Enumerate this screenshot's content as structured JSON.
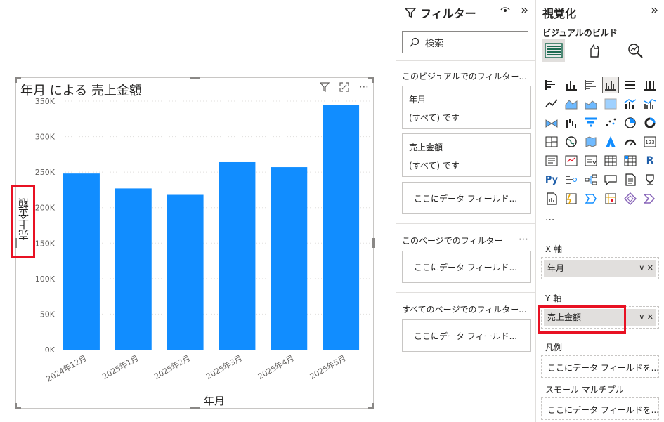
{
  "visual": {
    "title": "年月 による 売上金額",
    "icons": [
      "filter-icon",
      "focus-mode-icon",
      "more-options-icon"
    ],
    "x_axis_label": "年月",
    "y_axis_label": "売上金額"
  },
  "chart_data": {
    "type": "bar",
    "title": "年月 による 売上金額",
    "xlabel": "年月",
    "ylabel": "売上金額",
    "categories": [
      "2024年12月",
      "2025年1月",
      "2025年2月",
      "2025年3月",
      "2025年4月",
      "2025年5月"
    ],
    "values": [
      248000,
      227000,
      218000,
      264000,
      257000,
      345000
    ],
    "ylim": [
      0,
      350000
    ],
    "ytick_labels": [
      "0K",
      "50K",
      "100K",
      "150K",
      "200K",
      "250K",
      "300K",
      "350K"
    ],
    "color": "#118DFF",
    "grid": true
  },
  "filters": {
    "title": "フィルター",
    "search_placeholder": "検索",
    "visual_section": "このビジュアルでのフィルター...",
    "card1_field": "年月",
    "card1_state": "(すべて) です",
    "card2_field": "売上金額",
    "card2_state": "(すべて) です",
    "drop_text": "ここにデータ フィールド...",
    "page_section": "このページでのフィルター",
    "all_pages_section": "すべてのページでのフィルター..."
  },
  "visualizations": {
    "title": "視覚化",
    "build_label": "ビジュアルのビルド",
    "x_axis_label": "X 軸",
    "x_axis_field": "年月",
    "y_axis_label": "Y 軸",
    "y_axis_field": "売上金額",
    "legend_label": "凡例",
    "legend_drop": "ここにデータ フィールドを...",
    "small_multiples_label": "スモール マルチプル",
    "small_multiples_drop": "ここにデータ フィールドを...",
    "more": "..."
  }
}
